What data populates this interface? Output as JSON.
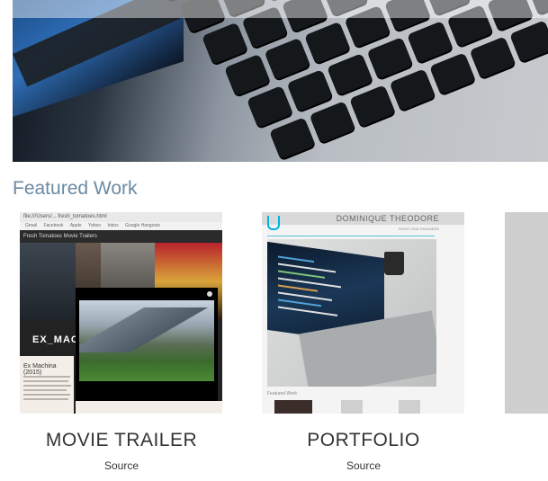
{
  "hero": {
    "alt_icon": "keyboard-photo"
  },
  "section": {
    "title": "Featured Work"
  },
  "projects": [
    {
      "title": "MOVIE TRAILER",
      "source_label": "Source",
      "screenshot": {
        "url_text": "file:///Users/... fresh_tomatoes.html",
        "bookmarks": [
          "Gmail",
          "Facebook",
          "Apple",
          "Yahoo",
          "Inbox",
          "Google Hangouts"
        ],
        "header": "Fresh Tomatoes Movie Trailers",
        "poster_text": "EX_MACHINA",
        "detail_title": "Ex Machina (2015)"
      }
    },
    {
      "title": "PORTFOLIO",
      "source_label": "Source",
      "screenshot": {
        "name": "DOMINIQUE THEODORE",
        "subtitle": "FRONT END ENGINEER",
        "featured_label": "Featured Work"
      }
    }
  ]
}
